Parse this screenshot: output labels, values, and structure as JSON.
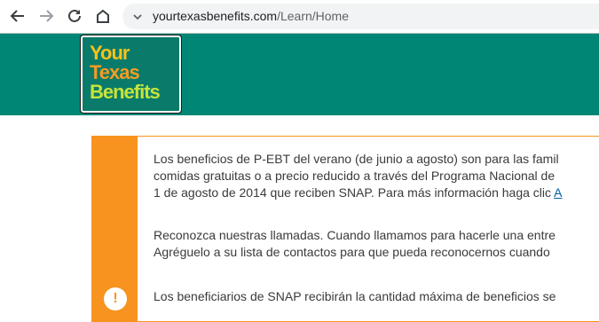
{
  "browser": {
    "url_host": "yourtexasbenefits.com",
    "url_path": "/Learn/Home",
    "icons": [
      "back-arrow-icon",
      "forward-arrow-icon",
      "reload-icon",
      "home-icon",
      "site-info-chevron-icon"
    ]
  },
  "header": {
    "logo_lines": [
      "Your",
      "Texas",
      "Benefits"
    ],
    "colors": {
      "header_bg": "#008675",
      "logo_your": "#f4c21c",
      "logo_texas": "#f79b22",
      "logo_benefits": "#c6e33b"
    }
  },
  "alert": {
    "accent_color": "#f7931e",
    "icon": "alert-exclamation-icon",
    "icon_glyph": "!",
    "paragraph1": {
      "line1": "Los beneficios de P-EBT del verano (de junio a agosto) son para las famil",
      "line2": "comidas gratuitas o a precio reducido a través del Programa Nacional de",
      "line3_text": "1 de agosto de 2014 que reciben SNAP. Para más información haga clic ",
      "line3_link": "A"
    },
    "paragraph2": {
      "line1": "Reconozca nuestras llamadas. Cuando llamamos para hacerle una entre",
      "line2": "Agréguelo a su lista de contactos para que pueda reconocernos cuando"
    },
    "paragraph3": {
      "line1": "Los beneficiarios de SNAP recibirán la cantidad máxima de beneficios se"
    }
  }
}
